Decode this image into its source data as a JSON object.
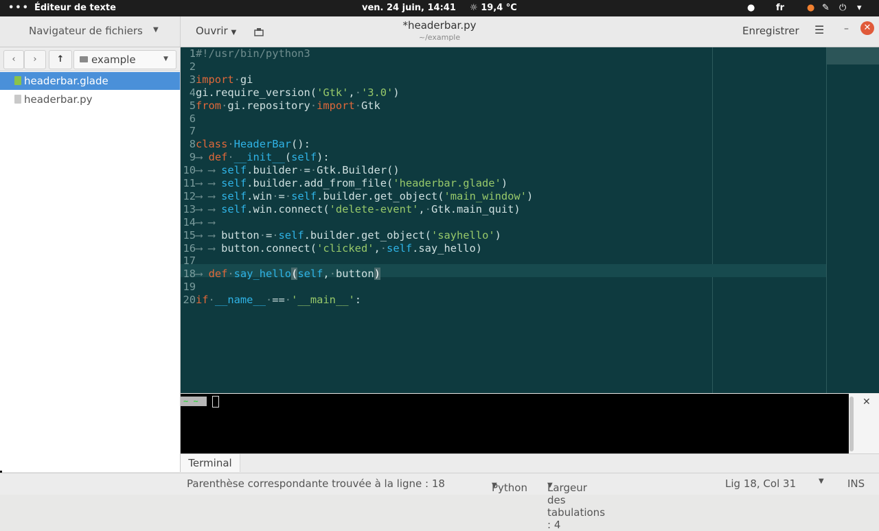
{
  "topbar": {
    "activities": "•••",
    "app_name": "Éditeur de texte",
    "datetime": "ven. 24 juin, 14:41",
    "weather": "19,4 °C",
    "language": "fr"
  },
  "header": {
    "nav_title": "Navigateur de fichiers",
    "open_label": "Ouvrir",
    "doc_title": "*headerbar.py",
    "doc_subtitle": "~/example",
    "save_label": "Enregistrer"
  },
  "sidebar": {
    "folder": "example",
    "files": [
      {
        "name": "headerbar.glade",
        "selected": true
      },
      {
        "name": "headerbar.py",
        "selected": false
      }
    ]
  },
  "editor": {
    "lines": [
      {
        "n": "1",
        "html": "<span class='cm'>#!/usr/bin/python3</span>"
      },
      {
        "n": "2",
        "html": ""
      },
      {
        "n": "3",
        "html": "<span class='kw'>import</span><span class='tab'>·</span>gi"
      },
      {
        "n": "4",
        "html": "gi.require_version(<span class='st'>'Gtk'</span>,<span class='tab'>·</span><span class='st'>'3.0'</span>)"
      },
      {
        "n": "5",
        "html": "<span class='kw'>from</span><span class='tab'>·</span>gi.repository<span class='tab'>·</span><span class='kw'>import</span><span class='tab'>·</span>Gtk"
      },
      {
        "n": "6",
        "html": ""
      },
      {
        "n": "7",
        "html": ""
      },
      {
        "n": "8",
        "html": "<span class='kw'>class</span><span class='tab'>·</span><span class='fn'>HeaderBar</span>():"
      },
      {
        "n": "9",
        "html": "<span class='tab'>⟶</span><span class='tab'> </span><span class='kw'>def</span><span class='tab'>·</span><span class='fn'>__init__</span>(<span class='fn'>self</span>):"
      },
      {
        "n": "10",
        "html": "<span class='tab'>⟶ ⟶</span> <span class='fn'>self</span>.builder<span class='tab'>·</span>=<span class='tab'>·</span>Gtk.Builder()"
      },
      {
        "n": "11",
        "html": "<span class='tab'>⟶ ⟶</span> <span class='fn'>self</span>.builder.add_from_file(<span class='st'>'headerbar.glade'</span>)"
      },
      {
        "n": "12",
        "html": "<span class='tab'>⟶ ⟶</span> <span class='fn'>self</span>.win<span class='tab'>·</span>=<span class='tab'>·</span><span class='fn'>self</span>.builder.get_object(<span class='st'>'main_window'</span>)"
      },
      {
        "n": "13",
        "html": "<span class='tab'>⟶ ⟶</span> <span class='fn'>self</span>.win.connect(<span class='st'>'delete-event'</span>,<span class='tab'>·</span>Gtk.main_quit)"
      },
      {
        "n": "14",
        "html": "<span class='tab'>⟶ ⟶</span>"
      },
      {
        "n": "15",
        "html": "<span class='tab'>⟶ ⟶</span> button<span class='tab'>·</span>=<span class='tab'>·</span><span class='fn'>self</span>.builder.get_object(<span class='st'>'sayhello'</span>)"
      },
      {
        "n": "16",
        "html": "<span class='tab'>⟶ ⟶</span> button.connect(<span class='st'>'clicked'</span>,<span class='tab'>·</span><span class='fn'>self</span>.say_hello)"
      },
      {
        "n": "17",
        "html": ""
      },
      {
        "n": "18",
        "html": "<span class='tab'>⟶</span><span class='tab'> </span><span class='kw'>def</span><span class='tab'>·</span><span class='fn'>say_hello</span><span class='bm'>(</span><span class='fn'>self</span>,<span class='tab'>·</span>button<span class='bm'>)</span>"
      },
      {
        "n": "19",
        "html": ""
      },
      {
        "n": "20",
        "html": "<span class='kw'>if</span><span class='tab'>·</span><span class='fn'>__name__</span><span class='tab'>·</span>==<span class='tab'>·</span><span class='st'>'__main__'</span>:"
      }
    ]
  },
  "terminal": {
    "prompt": "~ ~",
    "tab_label": "Terminal"
  },
  "statusbar": {
    "message": "Parenthèse correspondante trouvée à la ligne : 18",
    "language": "Python",
    "tab_width": "Largeur des tabulations : 4",
    "position": "Lig 18, Col 31",
    "mode": "INS"
  }
}
